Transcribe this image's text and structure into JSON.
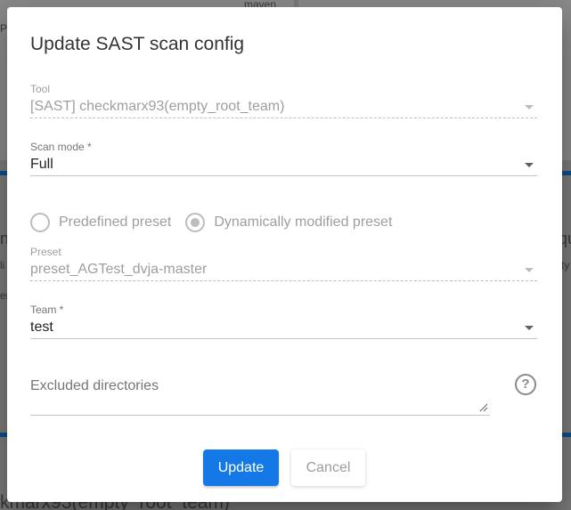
{
  "background": {
    "top_right_text": "maven",
    "left_fragment_1": "P",
    "left_fragment_2": "ns",
    "left_fragment_3": "li",
    "left_fragment_4": "er",
    "right_fragment_1": "qu",
    "right_fragment_2": "ty",
    "bottom_text": "kmarx93(empty_root_team)"
  },
  "dialog": {
    "title": "Update SAST scan config",
    "tool": {
      "label": "Tool",
      "value": "[SAST] checkmarx93(empty_root_team)"
    },
    "scan_mode": {
      "label": "Scan mode *",
      "value": "Full"
    },
    "preset_options": [
      {
        "label": "Predefined preset",
        "checked": false
      },
      {
        "label": "Dynamically modified preset",
        "checked": true
      }
    ],
    "preset": {
      "label": "Preset",
      "value": "preset_AGTest_dvja-master"
    },
    "team": {
      "label": "Team *",
      "value": "test"
    },
    "excluded": {
      "placeholder": "Excluded directories"
    },
    "help_icon": "question-circle-icon",
    "buttons": {
      "update": "Update",
      "cancel": "Cancel"
    }
  },
  "colors": {
    "primary": "#1479e6",
    "overlay": "#7b7b7b",
    "disabled_text": "#9e9e9e",
    "bg_accent": "#0b4f8f"
  }
}
